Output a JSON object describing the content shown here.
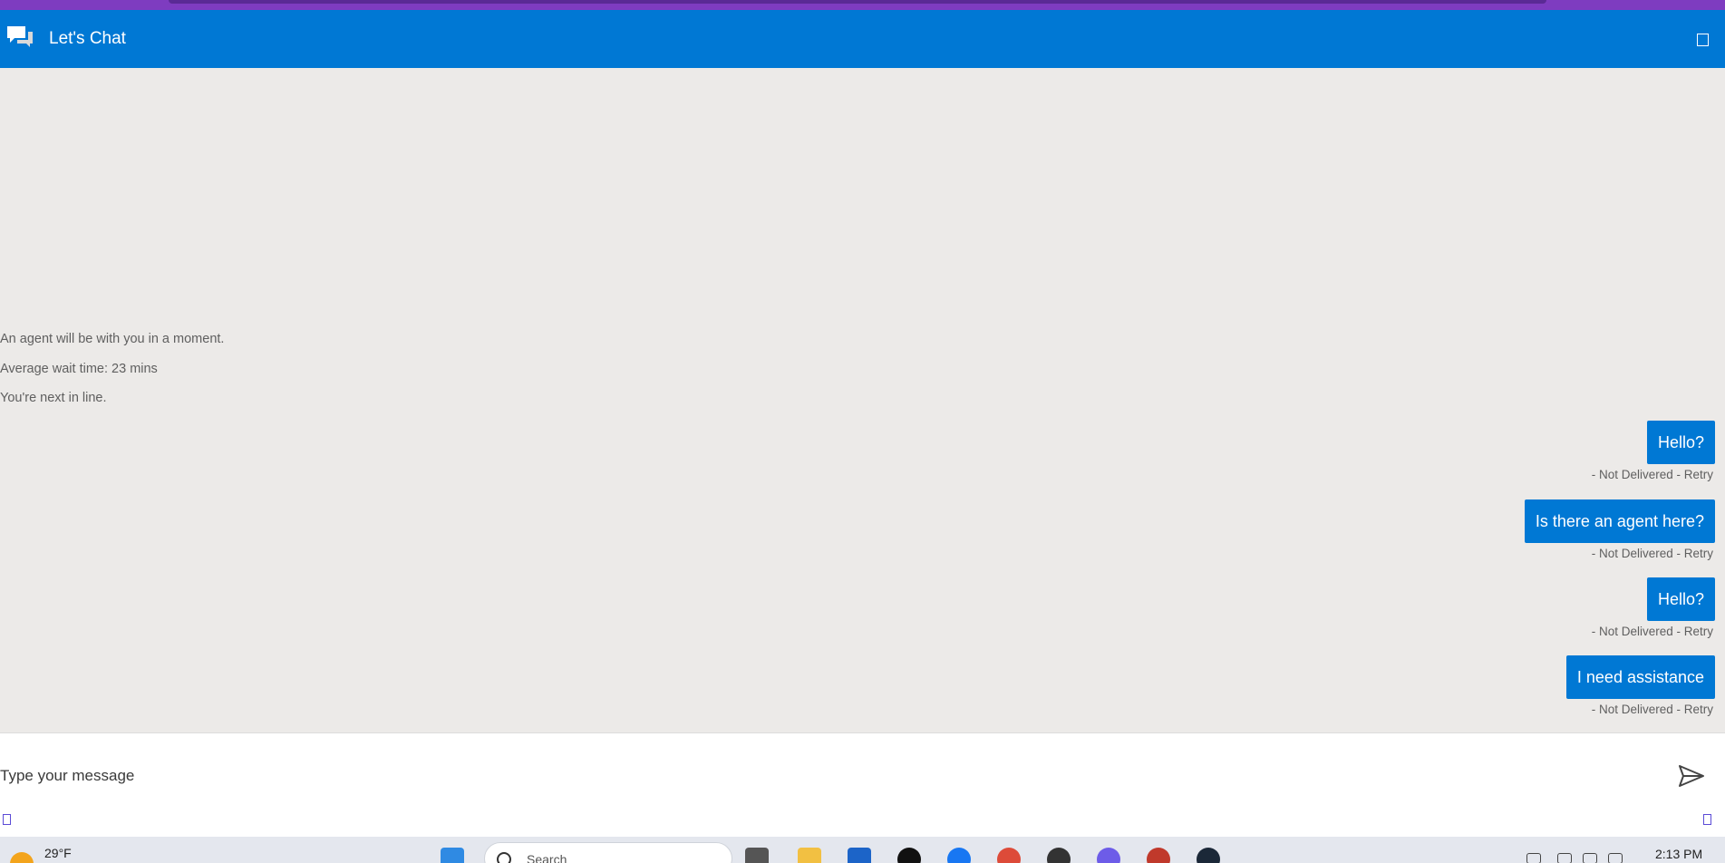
{
  "header": {
    "title": "Let's Chat"
  },
  "system_messages": [
    "An agent will be with you in a moment.",
    "Average wait time: 23 mins",
    "You're next in line."
  ],
  "messages": [
    {
      "text": "Hello?",
      "status": "- Not Delivered - Retry"
    },
    {
      "text": "Is there an agent here?",
      "status": "- Not Delivered - Retry"
    },
    {
      "text": "Hello?",
      "status": "- Not Delivered - Retry"
    },
    {
      "text": "I need assistance",
      "status": "- Not Delivered - Retry"
    }
  ],
  "composer": {
    "placeholder": "Type your message"
  },
  "taskbar": {
    "temperature": "29°F",
    "search_label": "Search",
    "time": "2:13 PM"
  },
  "colors": {
    "accent": "#0078d4",
    "background": "#eceae8",
    "browser_frame": "#7e3cc0"
  }
}
